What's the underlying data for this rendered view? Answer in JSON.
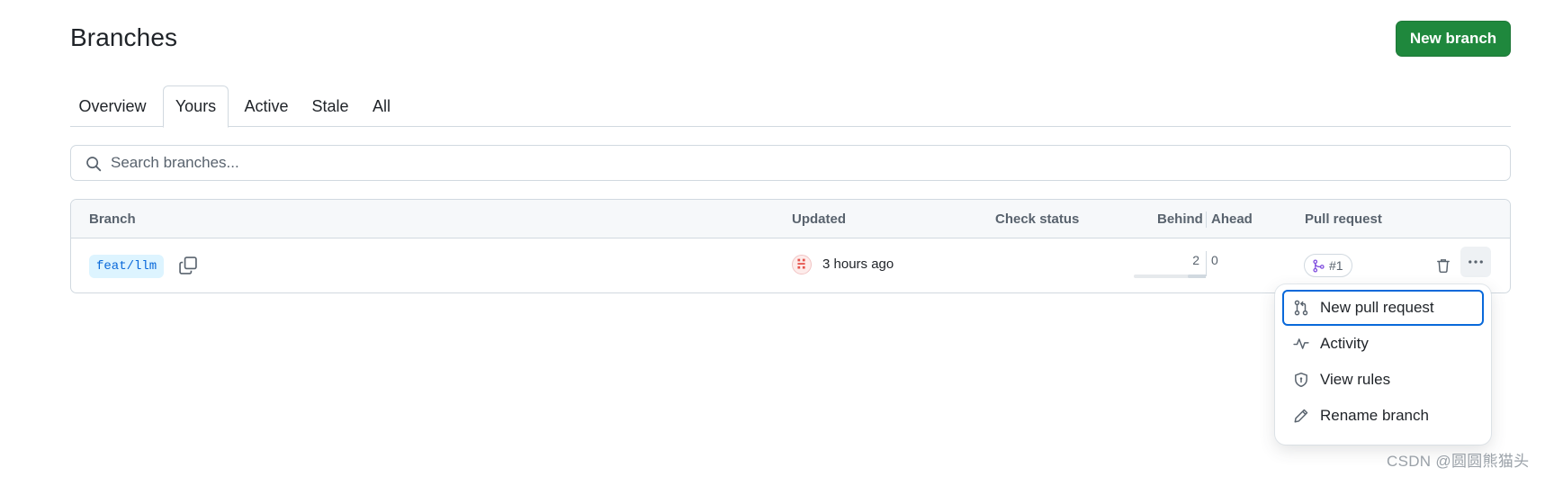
{
  "header": {
    "title": "Branches",
    "new_branch_label": "New branch"
  },
  "tabs": [
    {
      "label": "Overview",
      "selected": false
    },
    {
      "label": "Yours",
      "selected": true
    },
    {
      "label": "Active",
      "selected": false
    },
    {
      "label": "Stale",
      "selected": false
    },
    {
      "label": "All",
      "selected": false
    }
  ],
  "search": {
    "placeholder": "Search branches...",
    "value": ""
  },
  "table": {
    "headers": {
      "branch": "Branch",
      "updated": "Updated",
      "check_status": "Check status",
      "behind": "Behind",
      "ahead": "Ahead",
      "pull_request": "Pull request"
    },
    "rows": [
      {
        "branch": "feat/llm",
        "updated": "3 hours ago",
        "check_status": "",
        "behind": "2",
        "ahead": "0",
        "behind_fill_fraction": 0.25,
        "pull_request": "#1"
      }
    ]
  },
  "menu": {
    "items": [
      {
        "label": "New pull request",
        "icon": "git-pull-request-icon",
        "focused": true
      },
      {
        "label": "Activity",
        "icon": "pulse-icon",
        "focused": false
      },
      {
        "label": "View rules",
        "icon": "shield-icon",
        "focused": false
      },
      {
        "label": "Rename branch",
        "icon": "pencil-icon",
        "focused": false
      }
    ]
  },
  "watermark": "CSDN @圆圆熊猫头",
  "colors": {
    "primary_button": "#1f883d",
    "branch_tag_bg": "#ddf4ff",
    "branch_tag_text": "#0969da",
    "pr_merged_icon": "#8250df",
    "focus_ring": "#0969da",
    "border": "#d1d9e0",
    "muted_text": "#59636e"
  }
}
